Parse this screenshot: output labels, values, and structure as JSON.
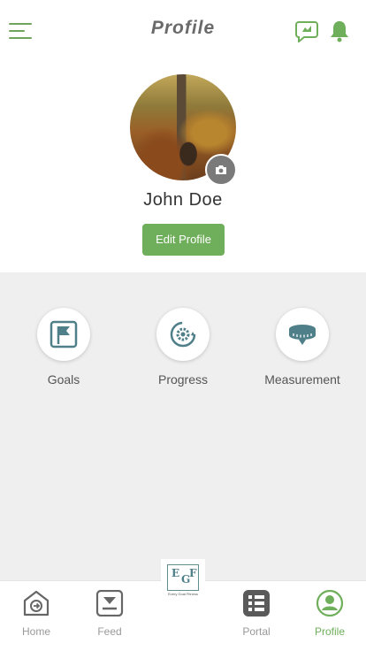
{
  "header": {
    "title": "Profile",
    "menu_icon": "hamburger-menu-icon",
    "chat_icon": "chat-bubble-icon",
    "bell_icon": "bell-icon"
  },
  "profile": {
    "name": "John Doe",
    "edit_label": "Edit Profile",
    "camera_icon": "camera-icon"
  },
  "actions": [
    {
      "label": "Goals",
      "icon": "goal-flag-icon"
    },
    {
      "label": "Progress",
      "icon": "progress-gear-icon"
    },
    {
      "label": "Measurement",
      "icon": "measuring-tape-icon"
    }
  ],
  "logo": {
    "letters": [
      "E",
      "G",
      "F"
    ],
    "tagline": "Every Goal Fitness"
  },
  "nav": {
    "items": [
      {
        "label": "Home",
        "icon": "home-icon",
        "active": false
      },
      {
        "label": "Feed",
        "icon": "feed-icon",
        "active": false
      },
      {
        "label": "Portal",
        "icon": "portal-icon",
        "active": false
      },
      {
        "label": "Profile",
        "icon": "profile-user-icon",
        "active": true
      }
    ]
  },
  "colors": {
    "accent": "#6fae5a",
    "background_grey": "#efefef",
    "icon_teal": "#4f7f88"
  }
}
